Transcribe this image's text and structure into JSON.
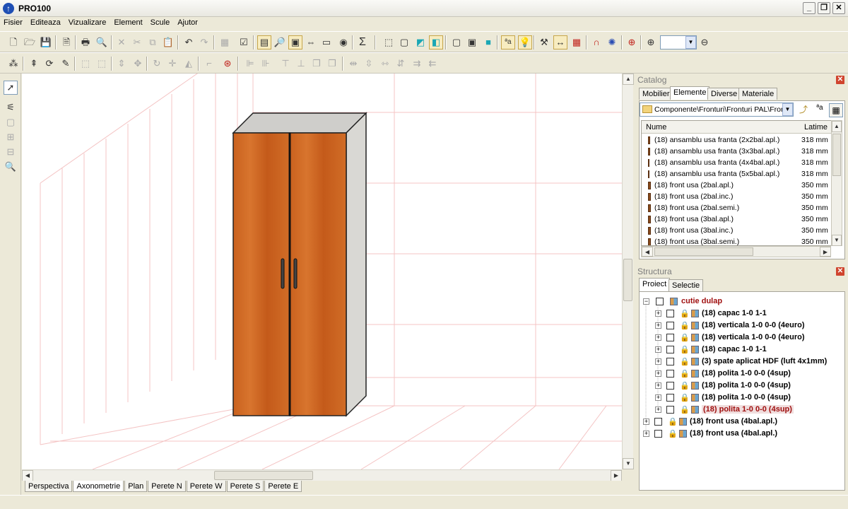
{
  "app": {
    "title": "PRO100"
  },
  "window": {
    "min_glyph": "_",
    "max_glyph": "❐",
    "close_glyph": "✕"
  },
  "menu": [
    "Fisier",
    "Editeaza",
    "Vizualizare",
    "Element",
    "Scule",
    "Ajutor"
  ],
  "toolbar": {
    "zoom_value": ""
  },
  "view_tabs": [
    "Perspectiva",
    "Axonometrie",
    "Plan",
    "Perete N",
    "Perete W",
    "Perete S",
    "Perete E"
  ],
  "catalog": {
    "title": "Catalog",
    "tabs": [
      "Mobilier",
      "Elemente",
      "Diverse",
      "Materiale"
    ],
    "path": "Componente\\Fronturi\\Fronturi PAL\\Fron",
    "columns": {
      "name": "Nume",
      "width": "Latime"
    },
    "rows": [
      {
        "name": "(18) ansamblu usa franta (2x2bal.apl.)",
        "width": "318 mm"
      },
      {
        "name": "(18) ansamblu usa franta (3x3bal.apl.)",
        "width": "318 mm"
      },
      {
        "name": "(18) ansamblu usa franta (4x4bal.apl.)",
        "width": "318 mm"
      },
      {
        "name": "(18) ansamblu usa franta (5x5bal.apl.)",
        "width": "318 mm"
      },
      {
        "name": "(18) front usa (2bal.apl.)",
        "width": "350 mm"
      },
      {
        "name": "(18) front usa (2bal.inc.)",
        "width": "350 mm"
      },
      {
        "name": "(18) front usa (2bal.semi.)",
        "width": "350 mm"
      },
      {
        "name": "(18) front usa (3bal.apl.)",
        "width": "350 mm"
      },
      {
        "name": "(18) front usa (3bal.inc.)",
        "width": "350 mm"
      },
      {
        "name": "(18) front usa (3bal.semi.)",
        "width": "350 mm"
      }
    ]
  },
  "structure": {
    "title": "Structura",
    "tabs": [
      "Proiect",
      "Selectie"
    ],
    "root": "cutie dulap",
    "children": [
      "(18) capac 1-0 1-1",
      "(18) verticala 1-0 0-0 (4euro)",
      "(18) verticala 1-0 0-0 (4euro)",
      "(18) capac 1-0 1-1",
      "(3) spate aplicat HDF (luft 4x1mm)",
      "(18) polita 1-0 0-0 (4sup)",
      "(18) polita 1-0 0-0 (4sup)",
      "(18) polita 1-0 0-0 (4sup)",
      "(18) polita 1-0 0-0 (4sup)"
    ],
    "top_items": [
      "(18) front usa (4bal.apl.)",
      "(18) front usa (4bal.apl.)"
    ]
  },
  "colors": {
    "door_wood": "#c9611e",
    "cabinet_side": "#d9d8d4",
    "grid_line": "#f2b8b8",
    "selected_text": "#a01010"
  }
}
